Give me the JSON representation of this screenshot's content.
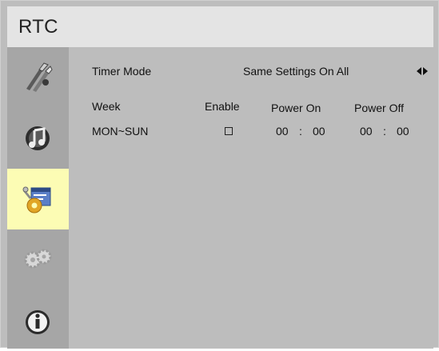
{
  "header": {
    "title": "RTC"
  },
  "sidebar": {
    "items": [
      {
        "icon": "tools-icon",
        "selected": false
      },
      {
        "icon": "audio-icon",
        "selected": false
      },
      {
        "icon": "settings-gear-icon",
        "selected": true
      },
      {
        "icon": "gears-icon",
        "selected": false
      },
      {
        "icon": "info-icon",
        "selected": false
      }
    ],
    "selected_color": "#fcfcb4"
  },
  "timer_mode": {
    "label": "Timer Mode",
    "value": "Same Settings On All",
    "arrows_icon": "left-right-arrows-icon"
  },
  "schedule": {
    "headers": {
      "week": "Week",
      "enable": "Enable",
      "power_on": "Power On",
      "power_off": "Power Off"
    },
    "rows": [
      {
        "week": "MON~SUN",
        "enabled": false,
        "power_on_hour": "00",
        "power_on_minute": "00",
        "power_off_hour": "00",
        "power_off_minute": "00",
        "separator": ":"
      }
    ]
  }
}
